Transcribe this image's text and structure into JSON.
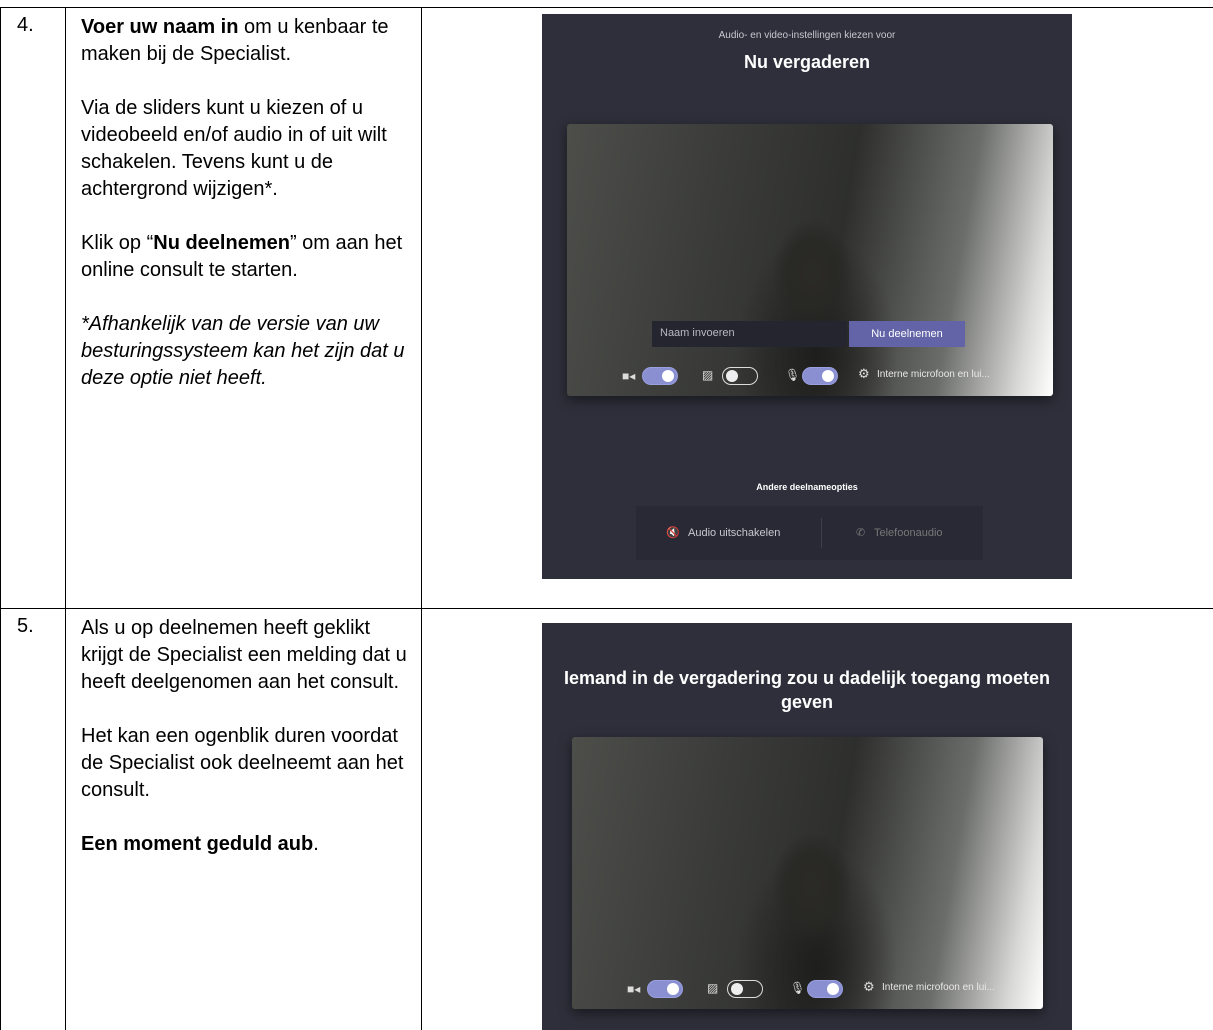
{
  "rows": [
    {
      "number": "4.",
      "p1_bold": "Voer uw naam in",
      "p1_rest": " om u kenbaar te maken bij de Specialist.",
      "p2": "Via de sliders kunt u kiezen of u videobeeld en/of audio in of uit wilt schakelen. Tevens kunt u de achtergrond wijzigen*.",
      "p3_pre": "Klik op “",
      "p3_bold": "Nu deelnemen",
      "p3_post": "” om aan het online consult te starten.",
      "p4_italic": "*Afhankelijk van de versie van uw besturingssysteem kan het zijn dat u deze optie niet heeft."
    },
    {
      "number": "5.",
      "p1": "Als u op deelnemen heeft geklikt krijgt de Specialist een melding dat u heeft deelgenomen aan het consult.",
      "p2": "Het kan een ogenblik duren voordat de Specialist ook deelneemt aan het consult.",
      "p3_bold": "Een moment geduld aub",
      "p3_post": "."
    }
  ],
  "screen1": {
    "subtitle": "Audio- en video-instellingen kiezen voor",
    "title": "Nu vergaderen",
    "name_placeholder": "Naam invoeren",
    "join_button": "Nu deelnemen",
    "device_label": "Interne microfoon en lui...",
    "other_options_label": "Andere deelnameopties",
    "audio_off": "Audio uitschakelen",
    "phone_audio": "Telefoonaudio",
    "toggles": {
      "camera": true,
      "background_blur": false,
      "microphone": true
    },
    "icons": [
      "camera-icon",
      "blur-icon",
      "microphone-icon",
      "gear-icon",
      "speaker-muted-icon",
      "phone-icon"
    ],
    "colors": {
      "background": "#2f2f3b",
      "accent": "#6264a7"
    }
  },
  "screen2": {
    "title": "Iemand in de vergadering zou u dadelijk toegang moeten geven",
    "device_label": "Interne microfoon en lui...",
    "toggles": {
      "camera": true,
      "background_blur": false,
      "microphone": true
    },
    "icons": [
      "camera-icon",
      "blur-icon",
      "microphone-icon",
      "gear-icon"
    ]
  }
}
